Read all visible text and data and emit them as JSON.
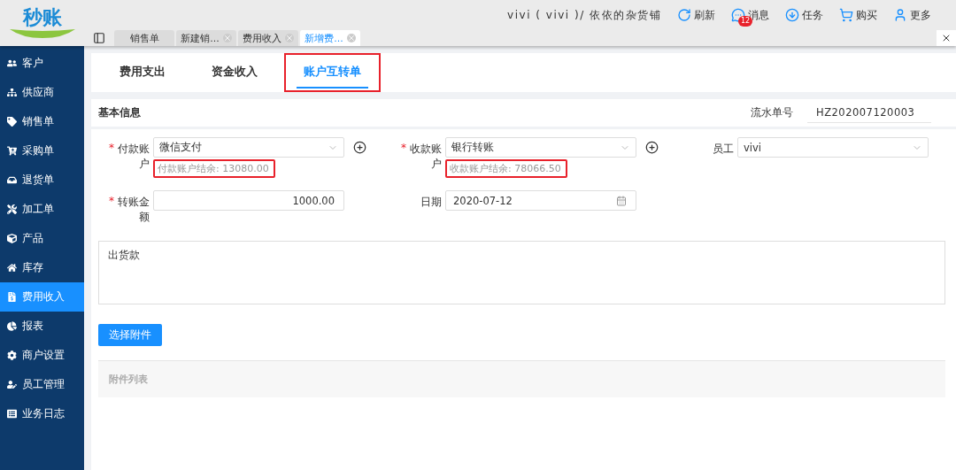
{
  "logo": {
    "text": "秒账"
  },
  "page_tabs": [
    {
      "label": "销售单",
      "selected": false,
      "closable": false
    },
    {
      "label": "新建销...",
      "selected": false,
      "closable": true
    },
    {
      "label": "费用收入",
      "selected": false,
      "closable": true
    },
    {
      "label": "新增费...",
      "selected": true,
      "closable": true
    }
  ],
  "user": {
    "text": "vivi ( vivi )/ 依依的杂货铺"
  },
  "actions": [
    {
      "kind": "refresh",
      "label": "刷新"
    },
    {
      "kind": "message",
      "label": "消息",
      "badge": "12"
    },
    {
      "kind": "task",
      "label": "任务"
    },
    {
      "kind": "buy",
      "label": "购买"
    },
    {
      "kind": "more",
      "label": "更多"
    }
  ],
  "sidebar": {
    "items": [
      {
        "label": "客户",
        "selected": false
      },
      {
        "label": "供应商",
        "selected": false
      },
      {
        "label": "销售单",
        "selected": false
      },
      {
        "label": "采购单",
        "selected": false
      },
      {
        "label": "退货单",
        "selected": false
      },
      {
        "label": "加工单",
        "selected": false
      },
      {
        "label": "产品",
        "selected": false
      },
      {
        "label": "库存",
        "selected": false
      },
      {
        "label": "费用收入",
        "selected": true
      },
      {
        "label": "报表",
        "selected": false
      },
      {
        "label": "商户设置",
        "selected": false
      },
      {
        "label": "员工管理",
        "selected": false
      },
      {
        "label": "业务日志",
        "selected": false
      }
    ]
  },
  "form_tabs": [
    {
      "label": "费用支出",
      "selected": false,
      "highlighted": false
    },
    {
      "label": "资金收入",
      "selected": false,
      "highlighted": false
    },
    {
      "label": "账户互转单",
      "selected": true,
      "highlighted": true
    }
  ],
  "section": {
    "title": "基本信息",
    "serial_label": "流水单号",
    "serial_value": "HZ202007120003"
  },
  "pay_account": {
    "label": "付款账户",
    "required": true,
    "value": "微信支付",
    "balance": "付款账户结余: 13080.00",
    "highlighted": true
  },
  "receive_account": {
    "label": "收款账户",
    "required": true,
    "value": "银行转账",
    "balance": "收款账户结余: 78066.50",
    "highlighted": true
  },
  "employee": {
    "label": "员工",
    "required": false,
    "value": "vivi"
  },
  "amount": {
    "label": "转账金额",
    "required": true,
    "value": "1000.00"
  },
  "date": {
    "label": "日期",
    "required": false,
    "value": "2020-07-12"
  },
  "note": {
    "value": "出货款"
  },
  "required_mark": "*",
  "attach_button": "选择附件",
  "attachments": {
    "title": "附件列表"
  }
}
